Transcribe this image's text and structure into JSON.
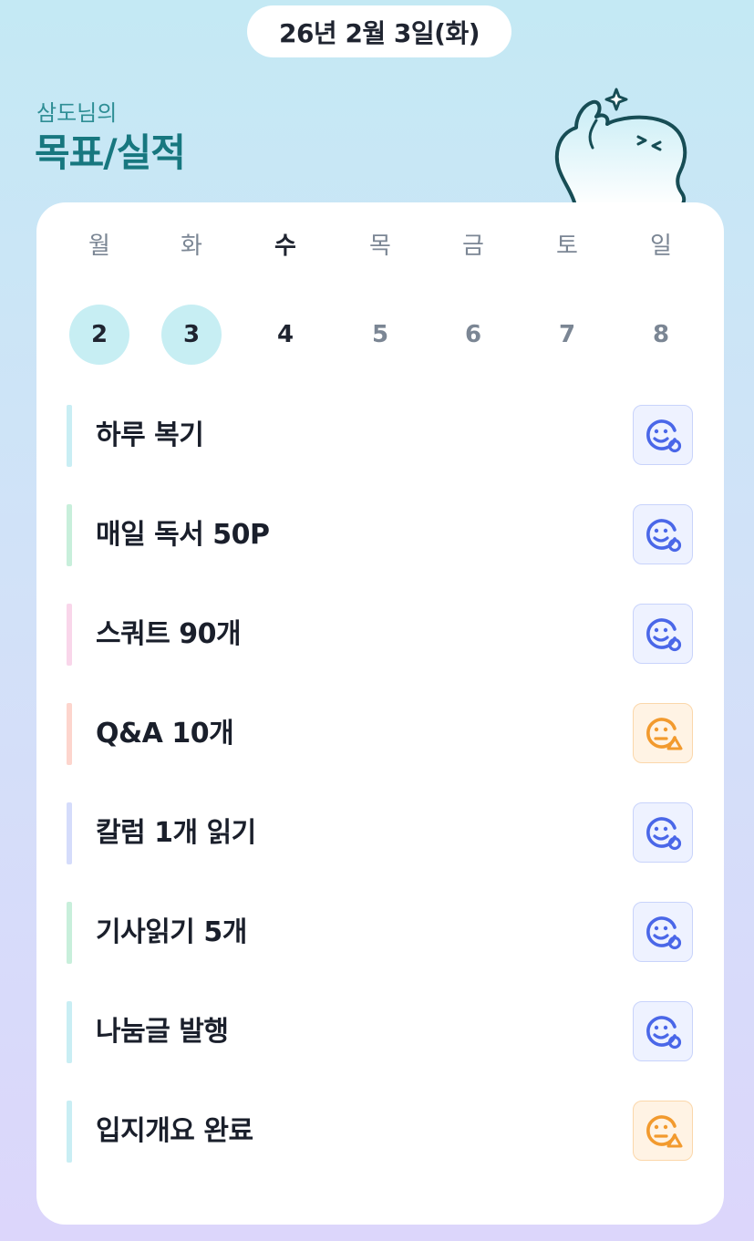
{
  "header": {
    "date": "26년 2월 3일(화)",
    "subtitle": "삼도님의",
    "title": "목표/실적"
  },
  "week": {
    "days": [
      {
        "name": "월",
        "num": "2",
        "state": "done"
      },
      {
        "name": "화",
        "num": "3",
        "state": "done"
      },
      {
        "name": "수",
        "num": "4",
        "state": "today"
      },
      {
        "name": "목",
        "num": "5",
        "state": "future"
      },
      {
        "name": "금",
        "num": "6",
        "state": "future"
      },
      {
        "name": "토",
        "num": "7",
        "state": "future"
      },
      {
        "name": "일",
        "num": "8",
        "state": "future"
      }
    ]
  },
  "goals": [
    {
      "label": "하루 복기",
      "bar_color": "#c9eef4",
      "status": "ok",
      "status_icon": "smile-check-icon"
    },
    {
      "label": "매일 독서 50P",
      "bar_color": "#c8efdb",
      "status": "ok",
      "status_icon": "smile-check-icon"
    },
    {
      "label": "스쿼트 90개",
      "bar_color": "#f9d6ea",
      "status": "ok",
      "status_icon": "smile-check-icon"
    },
    {
      "label": "Q&A 10개",
      "bar_color": "#fdd5cd",
      "status": "warn",
      "status_icon": "neutral-warning-icon"
    },
    {
      "label": "칼럼 1개 읽기",
      "bar_color": "#d5dcfb",
      "status": "ok",
      "status_icon": "smile-check-icon"
    },
    {
      "label": "기사읽기 5개",
      "bar_color": "#c8efdb",
      "status": "ok",
      "status_icon": "smile-check-icon"
    },
    {
      "label": "나눔글 발행",
      "bar_color": "#c9eef4",
      "status": "ok",
      "status_icon": "smile-check-icon"
    },
    {
      "label": "입지개요 완료",
      "bar_color": "#c9eef4",
      "status": "warn",
      "status_icon": "neutral-warning-icon"
    }
  ],
  "colors": {
    "ok": "#4a67e8",
    "warn": "#f29a2e"
  }
}
